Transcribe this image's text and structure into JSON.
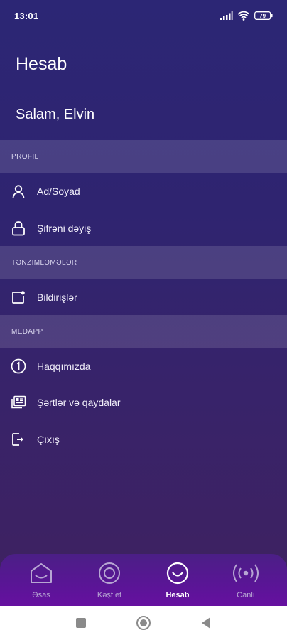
{
  "status_bar": {
    "time": "13:01",
    "battery": "79"
  },
  "header": {
    "title": "Hesab",
    "greeting": "Salam, Elvin"
  },
  "sections": {
    "profile": {
      "title": "PROFIL",
      "items": [
        {
          "label": "Ad/Soyad",
          "icon": "user-icon"
        },
        {
          "label": "Şifrəni dəyiş",
          "icon": "lock-icon"
        }
      ]
    },
    "settings": {
      "title": "TƏNZIMLƏMƏLƏR",
      "items": [
        {
          "label": "Bildirişlər",
          "icon": "notification-icon"
        }
      ]
    },
    "medapp": {
      "title": "MEDAPP",
      "items": [
        {
          "label": "Haqqımızda",
          "icon": "info-icon"
        },
        {
          "label": "Şərtlər və qaydalar",
          "icon": "document-icon"
        },
        {
          "label": "Çıxış",
          "icon": "logout-icon"
        }
      ]
    }
  },
  "bottom_nav": {
    "tabs": [
      {
        "label": "Əsas",
        "icon": "home-icon",
        "active": false
      },
      {
        "label": "Kəşf et",
        "icon": "discover-icon",
        "active": false
      },
      {
        "label": "Hesab",
        "icon": "account-smile-icon",
        "active": true
      },
      {
        "label": "Canlı",
        "icon": "live-broadcast-icon",
        "active": false
      }
    ]
  },
  "colors": {
    "background_top": "#2c2675",
    "background_bottom": "#3f2260",
    "nav_bar": "#5a1596",
    "inactive_tab": "#b7a6d3"
  }
}
